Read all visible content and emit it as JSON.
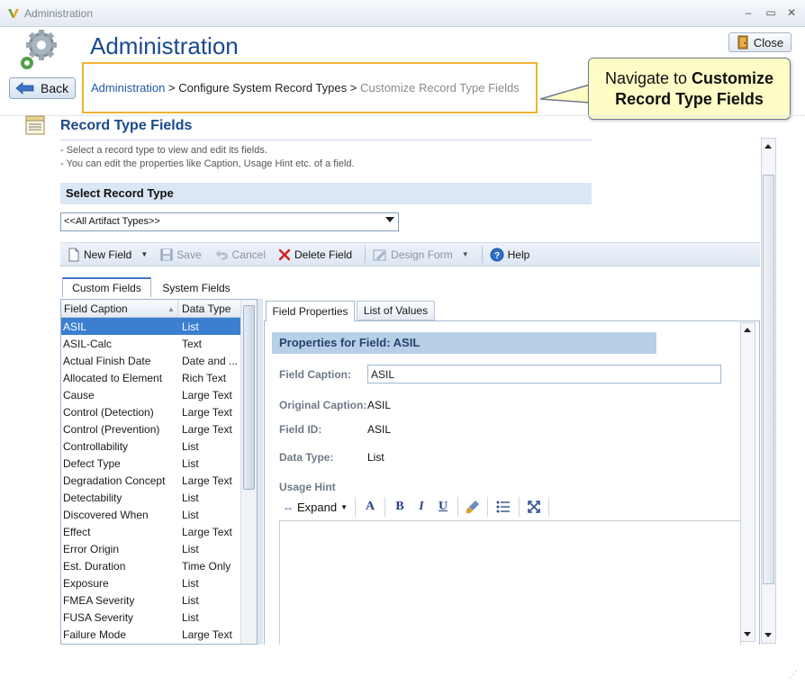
{
  "window": {
    "title": "Administration"
  },
  "header": {
    "title": "Administration",
    "back_label": "Back",
    "close_label": "Close"
  },
  "breadcrumb": {
    "link": "Administration",
    "sep": ">",
    "middle": "Configure System Record Types",
    "current": "Customize Record Type Fields"
  },
  "callout": {
    "text_plain": "Navigate to ",
    "text_bold": "Customize Record Type Fields"
  },
  "section": {
    "title": "Record Type Fields",
    "hints": [
      "-   Select a record type to view and edit its fields.",
      "-   You can edit the properties like Caption, Usage Hint etc. of a field."
    ]
  },
  "record_type": {
    "label": "Select Record Type",
    "selected": "<<All Artifact Types>>"
  },
  "toolbar": {
    "new_field": "New Field",
    "save": "Save",
    "cancel": "Cancel",
    "delete_field": "Delete Field",
    "design_form": "Design Form",
    "help": "Help"
  },
  "left_tabs": {
    "custom": "Custom Fields",
    "system": "System Fields"
  },
  "grid": {
    "headers": {
      "caption": "Field Caption",
      "type": "Data Type"
    },
    "rows": [
      {
        "caption": "ASIL",
        "type": "List"
      },
      {
        "caption": "ASIL-Calc",
        "type": "Text"
      },
      {
        "caption": "Actual Finish Date",
        "type": "Date and ..."
      },
      {
        "caption": "Allocated to Element",
        "type": "Rich Text"
      },
      {
        "caption": "Cause",
        "type": "Large Text"
      },
      {
        "caption": "Control (Detection)",
        "type": "Large Text"
      },
      {
        "caption": "Control (Prevention)",
        "type": "Large Text"
      },
      {
        "caption": "Controllability",
        "type": "List"
      },
      {
        "caption": "Defect Type",
        "type": "List"
      },
      {
        "caption": "Degradation Concept",
        "type": "Large Text"
      },
      {
        "caption": "Detectability",
        "type": "List"
      },
      {
        "caption": "Discovered When",
        "type": "List"
      },
      {
        "caption": "Effect",
        "type": "Large Text"
      },
      {
        "caption": "Error Origin",
        "type": "List"
      },
      {
        "caption": "Est. Duration",
        "type": "Time Only"
      },
      {
        "caption": "Exposure",
        "type": "List"
      },
      {
        "caption": "FMEA Severity",
        "type": "List"
      },
      {
        "caption": "FUSA Severity",
        "type": "List"
      },
      {
        "caption": "Failure Mode",
        "type": "Large Text"
      }
    ]
  },
  "right_tabs": {
    "properties": "Field Properties",
    "lov": "List of Values"
  },
  "properties": {
    "band_prefix": "Properties for Field: ",
    "band_field": "ASIL",
    "caption_label": "Field Caption:",
    "caption_value": "ASIL",
    "original_label": "Original Caption:",
    "original_value": "ASIL",
    "id_label": "Field ID:",
    "id_value": "ASIL",
    "type_label": "Data Type:",
    "type_value": "List",
    "usage_label": "Usage Hint"
  },
  "editor": {
    "expand": "Expand"
  }
}
